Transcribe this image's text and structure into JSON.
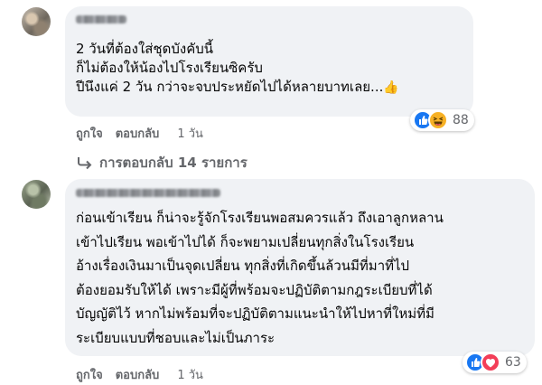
{
  "comments": [
    {
      "text_lines": [
        "2 วันที่ต้องใส่ชุดบังคับนี้",
        "ก็ไม่ต้องให้น้องไปโรงเรียนซิครับ",
        "ปีนึงแค่ 2 วัน กว่าจะจบประหยัดไปได้หลายบาทเลย..."
      ],
      "like_label": "ถูกใจ",
      "reply_label": "ตอบกลับ",
      "time": "1 วัน",
      "reaction_count": "88",
      "reactions": [
        "like-icon",
        "haha-icon"
      ]
    },
    {
      "text_lines": [
        "ก่อนเข้าเรียน ก็น่าจะรู้จักโรงเรียนพอสมควรแล้ว ถึงเอาลูกหลาน",
        "เข้าไปเรียน พอเข้าไปได้ ก็จะพยามเปลี่ยนทุกสิ่งในโรงเรียน",
        "อ้างเรื่องเงินมาเป็นจุดเปลี่ยน ทุกสิ่งที่เกิดขึ้นล้วนมีที่มาที่ไป",
        "ต้องยอมรับให้ได้ เพราะมีผู้ที่พร้อมจะปฏิบัติตามกฎระเบียบที่ได้",
        "บัญญัติไว้ หากไม่พร้อมที่จะปฏิบัติตามแนะนำให้ไปหาที่ใหม่ที่มี",
        "ระเบียบแบบที่ชอบและไม่เป็นภาระ"
      ],
      "like_label": "ถูกใจ",
      "reply_label": "ตอบกลับ",
      "time": "1 วัน",
      "reaction_count": "63",
      "reactions": [
        "like-icon",
        "love-icon"
      ]
    }
  ],
  "replies_link": "การตอบกลับ 14 รายการ",
  "colors": {
    "bubble": "#f0f2f5",
    "meta_text": "#65676b",
    "like_blue": "#1877f2",
    "love_red": "#f33e58",
    "haha_yellow": "#f7b125"
  }
}
